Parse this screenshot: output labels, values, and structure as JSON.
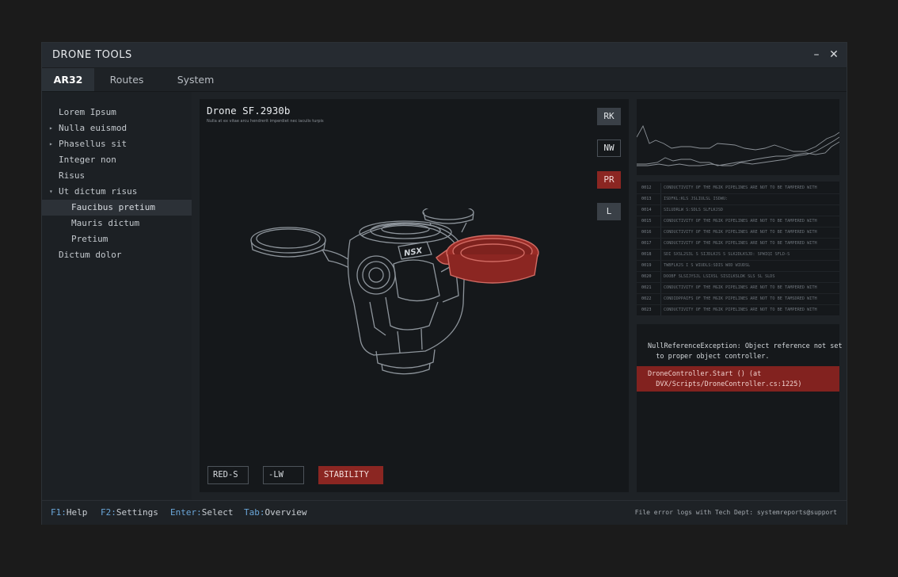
{
  "window": {
    "title": "DRONE TOOLS",
    "minimize_glyph": "–",
    "close_glyph": "✕"
  },
  "tabs": [
    {
      "label": "AR32",
      "active": true
    },
    {
      "label": "Routes",
      "active": false
    },
    {
      "label": "System",
      "active": false
    }
  ],
  "sidebar": {
    "items": [
      {
        "label": "Lorem Ipsum",
        "arrow": "",
        "level": 0
      },
      {
        "label": "Nulla euismod",
        "arrow": "▸",
        "level": 0
      },
      {
        "label": "Phasellus sit",
        "arrow": "▸",
        "level": 0
      },
      {
        "label": "Integer non",
        "arrow": "",
        "level": 0
      },
      {
        "label": "Risus",
        "arrow": "",
        "level": 0
      },
      {
        "label": "Ut dictum risus",
        "arrow": "▾",
        "level": 0
      },
      {
        "label": "Faucibus pretium",
        "arrow": "",
        "level": 1,
        "selected": true
      },
      {
        "label": "Mauris dictum",
        "arrow": "",
        "level": 1
      },
      {
        "label": "Pretium",
        "arrow": "",
        "level": 1
      },
      {
        "label": "Dictum dolor",
        "arrow": "",
        "level": 0
      }
    ]
  },
  "viewer": {
    "title": "Drone SF.2930b",
    "subtitle": "Nulla at ex vitae arcu hendrerit imperdiet nec iaculis turpis",
    "side_buttons": [
      {
        "label": "RK",
        "style": "filled"
      },
      {
        "label": "NW",
        "style": "outline"
      },
      {
        "label": "PR",
        "style": "red"
      },
      {
        "label": "L",
        "style": "filled"
      }
    ],
    "bottom_buttons": [
      {
        "label": "RED-S",
        "style": "outline"
      },
      {
        "label": "-LW",
        "style": "outline"
      },
      {
        "label": "STABILITY",
        "style": "red"
      }
    ],
    "drone_logo": "NSX",
    "highlight_color": "#8b2622"
  },
  "log": {
    "rows": [
      {
        "num": "0012",
        "msg": "CONDUCTIVITY OF THE MGIK PIPELINES ARE NOT TO BE TAMPERED WITH"
      },
      {
        "num": "0013",
        "msg": "ISDFKL:KLS JSLIULSL ISDWU:"
      },
      {
        "num": "0014",
        "msg": "SILUDRLW S:SDLS  SLFLKJSD"
      },
      {
        "num": "0015",
        "msg": "CONDUCTIVITY OF THE MGIK PIPELINES ARE NOT TO BE TAMPERED WITH"
      },
      {
        "num": "0016",
        "msg": "CONDUCTIVITY OF THE MGIK PIPELINES ARE NOT TO BE TAMPERED WITH"
      },
      {
        "num": "0017",
        "msg": "CONDUCTIVITY OF THE MGIK PIPELINES ARE NOT TO BE TAMPERED WITH"
      },
      {
        "num": "0018",
        "msg": "SDI SXSL2S3L S SIJDLKJS S SLK2DLKSJD: SPWIQI SFLD-S"
      },
      {
        "num": "0019",
        "msg": "TWBFLKJS I S WIUDLS:SDIS WOD  WIUDSL"
      },
      {
        "num": "0020",
        "msg": "DOOBF SLSIJYSJL LSIXSL SISILKSLDK SLS SL SLDS"
      },
      {
        "num": "0021",
        "msg": "CONDUCTIVITY OF THE MGIK PIPELINES ARE NOT TO BE TAMPERED WITH"
      },
      {
        "num": "0022",
        "msg": "CONDIDPPAIFS OF THE MGIK PIPELINES ARE NOT TO BE TAMSDRED WITH"
      },
      {
        "num": "0023",
        "msg": "CONDUCTIVITY OF THE MGIK PIPELINES ARE NOT TO BE TAMPERED WITH"
      }
    ]
  },
  "error": {
    "message": "NullReferenceException: Object reference not set\n  to proper object controller.",
    "trace": "DroneController.Start () (at\n  DVX/Scripts/DroneController.cs:1225)"
  },
  "statusbar": {
    "items": [
      {
        "key": "F1:",
        "label": "Help"
      },
      {
        "key": "F2:",
        "label": "Settings"
      },
      {
        "key": "Enter:",
        "label": "Select"
      },
      {
        "key": "Tab:",
        "label": "Overview"
      }
    ],
    "right": "File error logs with Tech Dept: systemreports@support",
    "key_color": "#6aa6d8"
  }
}
